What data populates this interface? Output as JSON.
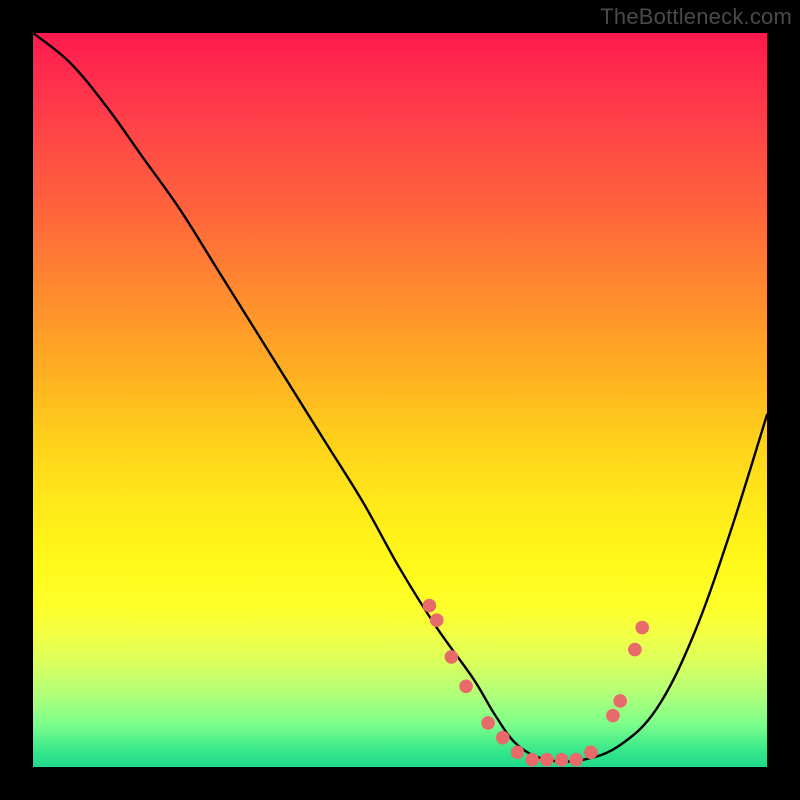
{
  "watermark": "TheBottleneck.com",
  "chart_data": {
    "type": "line",
    "title": "",
    "xlabel": "",
    "ylabel": "",
    "xlim": [
      0,
      100
    ],
    "ylim": [
      0,
      100
    ],
    "series": [
      {
        "name": "bottleneck-curve",
        "x": [
          0,
          5,
          10,
          15,
          20,
          25,
          30,
          35,
          40,
          45,
          50,
          55,
          60,
          63,
          66,
          70,
          75,
          80,
          85,
          90,
          95,
          100
        ],
        "y": [
          100,
          96,
          90,
          83,
          76,
          68,
          60,
          52,
          44,
          36,
          27,
          19,
          12,
          7,
          3,
          1,
          1,
          3,
          8,
          18,
          32,
          48
        ]
      }
    ],
    "markers": {
      "name": "highlight-dots",
      "color": "#e86a6a",
      "x": [
        54,
        55,
        57,
        59,
        62,
        64,
        66,
        68,
        70,
        72,
        74,
        76,
        79,
        80,
        82,
        83
      ],
      "y": [
        22,
        20,
        15,
        11,
        6,
        4,
        2,
        1,
        1,
        1,
        1,
        2,
        7,
        9,
        16,
        19
      ]
    }
  }
}
